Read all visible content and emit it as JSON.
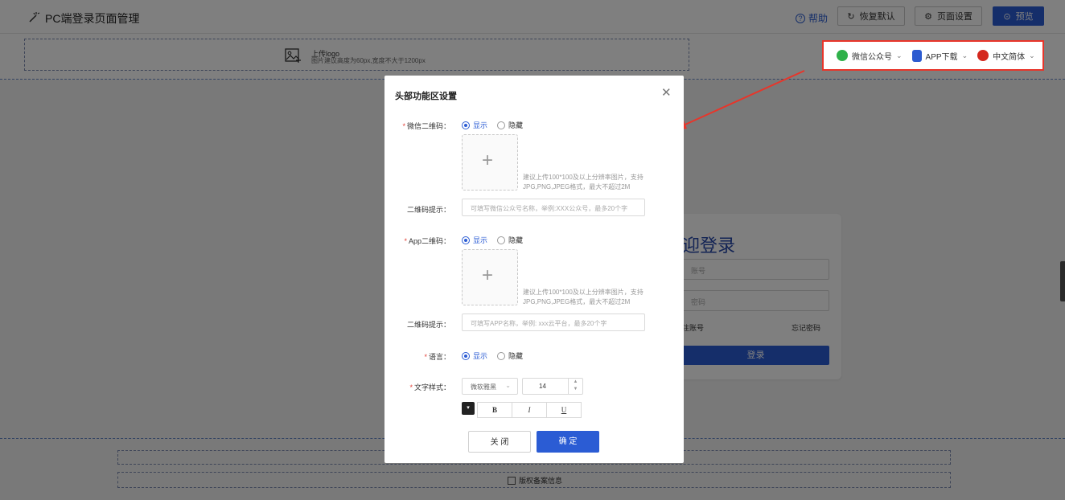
{
  "topbar": {
    "title": "PC端登录页面管理",
    "help": "帮助",
    "restore": "恢复默认",
    "settings": "页面设置",
    "preview": "预览"
  },
  "header": {
    "logo_title": "上传logo",
    "logo_hint": "图片建议高度为60px,宽度不大于1200px",
    "func_items": [
      "微信公众号",
      "APP下载",
      "中文简体"
    ]
  },
  "login": {
    "welcome": "迎登录",
    "account_placeholder": "账号",
    "password_placeholder": "密码",
    "register": "注账号",
    "forgot": "忘记密码",
    "submit": "登录"
  },
  "footer": {
    "copyright": "版权备案信息"
  },
  "modal": {
    "title": "头部功能区设置",
    "wechat_label": "微信二维码：",
    "app_label": "App二维码：",
    "lang_label": "语言：",
    "text_style_label": "文字样式：",
    "qr_hint_label": "二维码提示：",
    "show": "显示",
    "hide": "隐藏",
    "upload_hint": "建议上传100*100及以上分辨率图片，支持JPG,PNG,JPEG格式，最大不超过2M",
    "wechat_tip_placeholder": "可填写微信公众号名称，举例:XXX公众号，最多20个字",
    "app_tip_placeholder": "可填写APP名称，举例: xxx云平台，最多20个字",
    "font_family": "微软雅黑",
    "font_size": "14",
    "bold": "B",
    "italic": "I",
    "underline": "U",
    "cancel": "关 闭",
    "ok": "确 定"
  },
  "colors": {
    "primary": "#2b5cd4",
    "highlight": "#e8352a"
  }
}
